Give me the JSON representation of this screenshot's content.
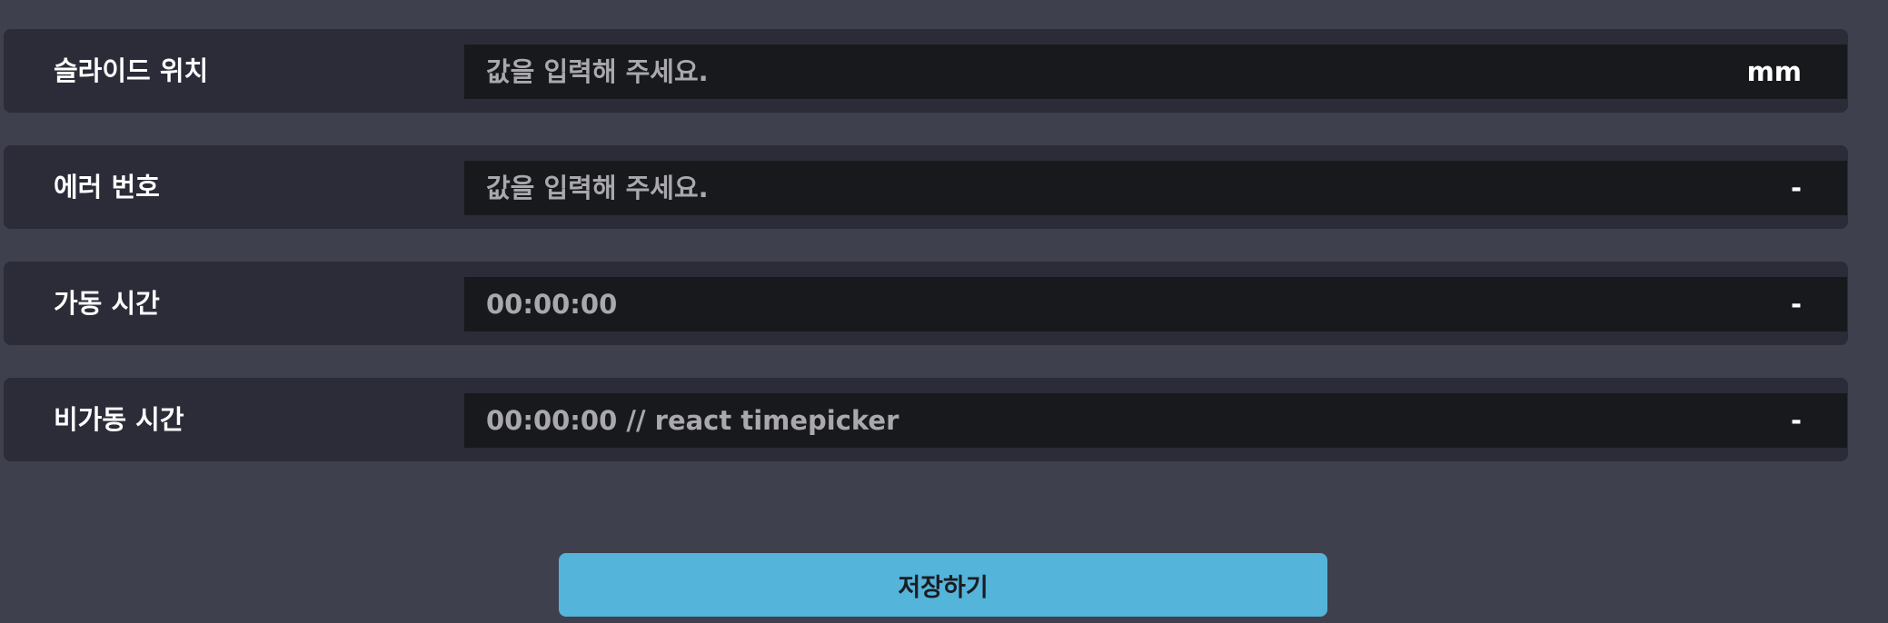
{
  "form": {
    "rows": [
      {
        "label": "슬라이드 위치",
        "placeholder": "값을 입력해 주세요.",
        "unit": "mm"
      },
      {
        "label": "에러 번호",
        "placeholder": "값을 입력해 주세요.",
        "unit": "-"
      },
      {
        "label": "가동 시간",
        "placeholder": "00:00:00",
        "unit": "-"
      },
      {
        "label": "비가동 시간",
        "placeholder": "00:00:00 // react timepicker",
        "unit": "-"
      }
    ],
    "save_label": "저장하기"
  },
  "colors": {
    "page_bg": "#3e404e",
    "row_bg": "#2b2c38",
    "field_bg": "#18191d",
    "accent": "#54b4da"
  }
}
